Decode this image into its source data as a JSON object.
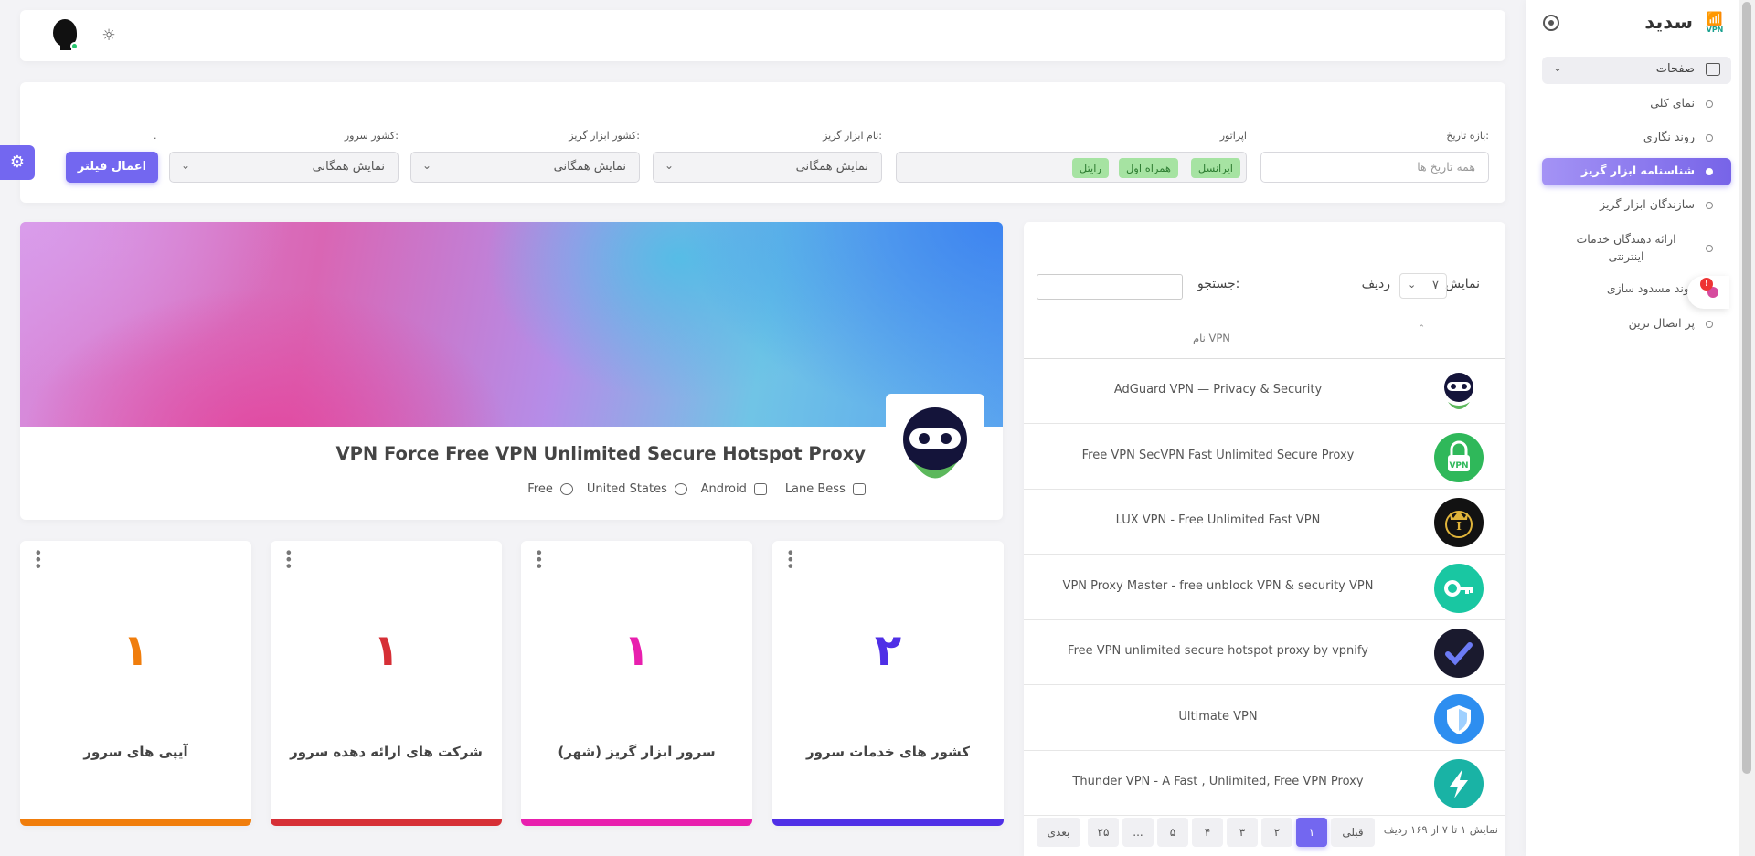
{
  "brand": {
    "title": "سدید",
    "logo_text": "VPN"
  },
  "sidebar": {
    "group_label": "صفحات",
    "items": [
      {
        "label": "نمای کلی",
        "active": false
      },
      {
        "label": "روند نگاری",
        "active": false
      },
      {
        "label": "شناسنامه ابزار گریز",
        "active": true
      },
      {
        "label": "سازندگان ابزار گریز",
        "active": false
      },
      {
        "label": "ارائه دهندگان خدمات اینترنتی",
        "active": false
      },
      {
        "label": "روند مسدود سازی",
        "active": false
      },
      {
        "label": "پر اتصال ترین",
        "active": false
      }
    ],
    "badge_count": "!"
  },
  "filters": {
    "date_label": "بازه تاریخ:",
    "date_placeholder": "همه تاریخ ها",
    "operator_label": "اپراتور",
    "operator_tags": [
      "ایرانسل",
      "همراه اول",
      "رایتل"
    ],
    "tool_name_label": "نام ابزار گریز:",
    "tool_name_value": "نمایش همگانی",
    "tool_country_label": "کشور ابزار گریز:",
    "tool_country_value": "نمایش همگانی",
    "server_country_label": "کشور سرور:",
    "server_country_value": "نمایش همگانی",
    "dot_label": ".",
    "apply_label": "اعمال فیلتر"
  },
  "list": {
    "show_label": "نمایش",
    "page_size": "۷",
    "rows_label": "ردیف",
    "search_label": "جستجو:",
    "search_value": "",
    "column_header": "نام VPN",
    "rows": [
      {
        "name": "AdGuard VPN — Privacy & Security",
        "icon": "adguard-ninja-icon",
        "color": "#ffffff"
      },
      {
        "name": "Free VPN SecVPN Fast Unlimited Secure Proxy",
        "icon": "secvpn-lock-icon",
        "color": "#2fb85a"
      },
      {
        "name": "LUX VPN - Free Unlimited Fast VPN",
        "icon": "lux-crown-icon",
        "color": "#121212"
      },
      {
        "name": "VPN Proxy Master - free unblock VPN & security VPN",
        "icon": "key-icon",
        "color": "#19c7a2"
      },
      {
        "name": "Free VPN unlimited secure hotspot proxy by vpnify",
        "icon": "check-icon",
        "color": "#1a1a2e"
      },
      {
        "name": "Ultimate VPN",
        "icon": "shield-icon",
        "color": "#2d8ef0"
      },
      {
        "name": "Thunder VPN - A Fast , Unlimited, Free VPN Proxy",
        "icon": "lightning-icon",
        "color": "#19b3a5"
      }
    ],
    "info": "نمایش ۱ تا ۷ از ۱۶۹ ردیف",
    "pagination": {
      "prev": "قبلی",
      "pages": [
        "۱",
        "۲",
        "۳",
        "۴",
        "۵",
        "...",
        "۲۵"
      ],
      "next": "بعدی",
      "current": "۱"
    }
  },
  "detail": {
    "app_name": "VPN Force Free VPN Unlimited Secure Hotspot Proxy",
    "developer": "Lane Bess",
    "platform": "Android",
    "country": "United States",
    "price": "Free"
  },
  "stats": [
    {
      "value": "۲",
      "label": "کشور های خدمات سرور",
      "color": "#4f2fe6"
    },
    {
      "value": "۱",
      "label": "سرور ابزار گریز (شهر)",
      "color": "#e81fae"
    },
    {
      "value": "۱",
      "label": "شرکت های ارائه دهده سرور",
      "color": "#d62f36"
    },
    {
      "value": "۱",
      "label": "آیپی های سرور",
      "color": "#f07d0c"
    }
  ]
}
